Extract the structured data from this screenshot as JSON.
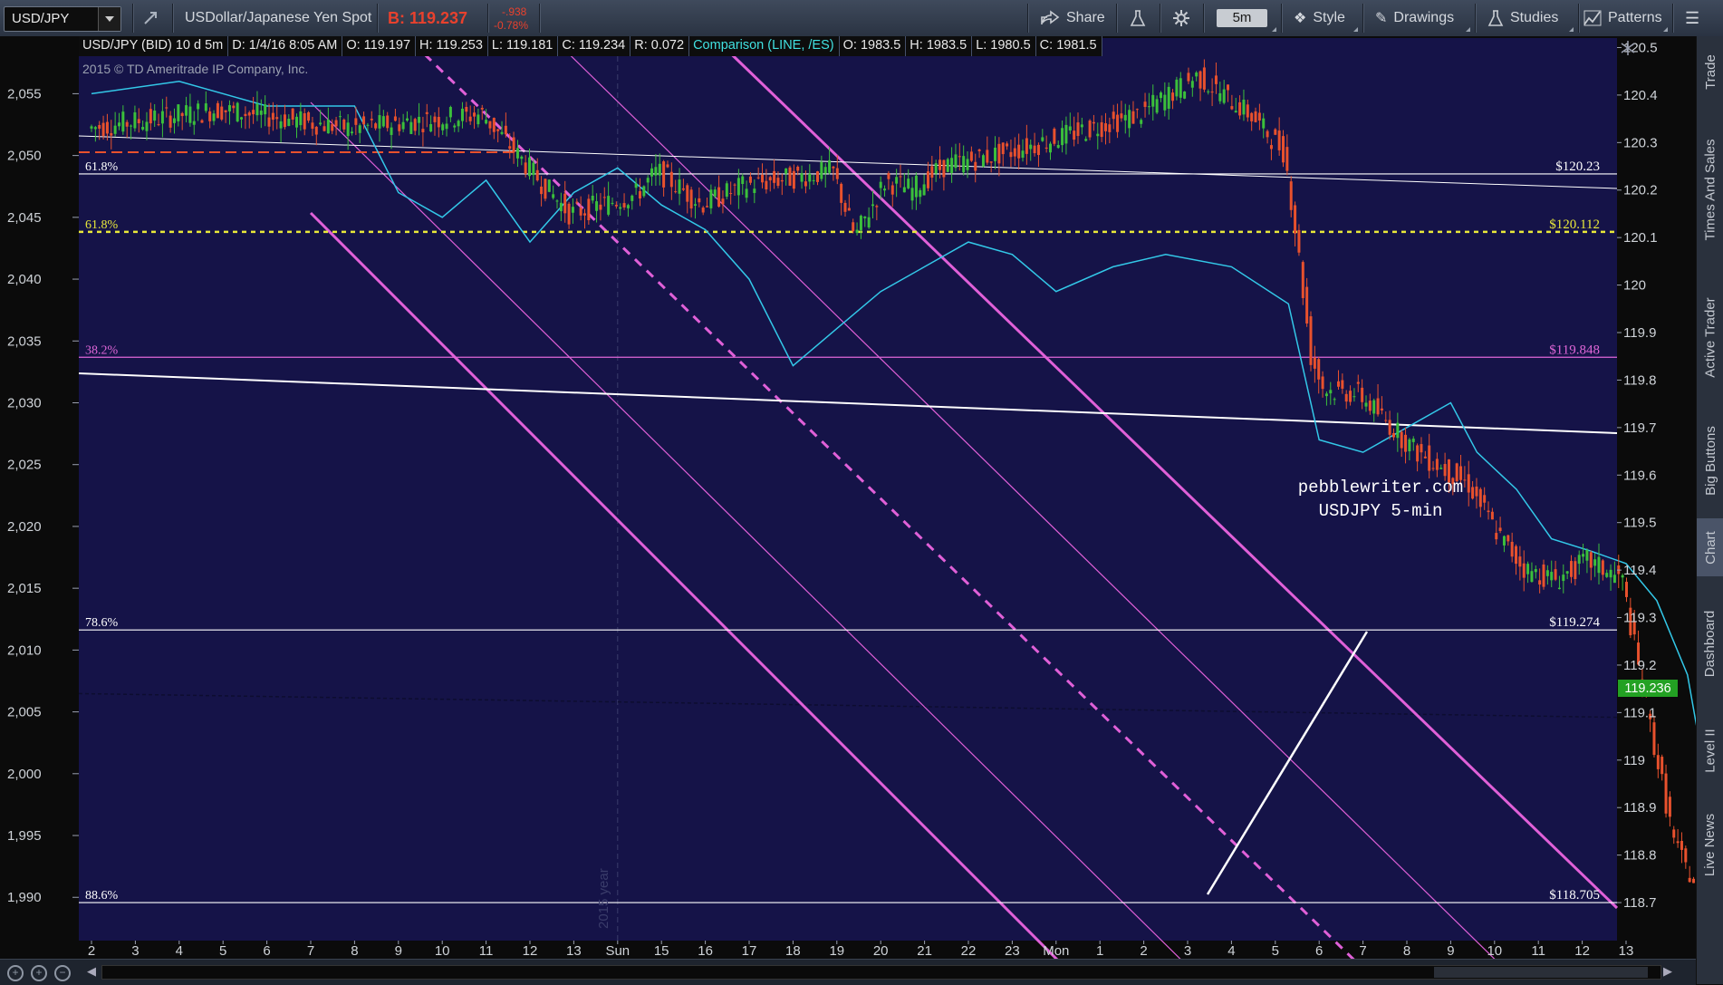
{
  "toolbar": {
    "symbol": "USD/JPY",
    "description": "USDollar/Japanese Yen Spot",
    "bid": "B: 119.237",
    "change": "-.938",
    "change_pct": "-0.78%",
    "share": "Share",
    "interval": "5m",
    "style": "Style",
    "drawings": "Drawings",
    "studies": "Studies",
    "patterns": "Patterns"
  },
  "info_bar": {
    "title": "USD/JPY (BID) 10 d 5m",
    "date": "D: 1/4/16 8:05 AM",
    "open": "O: 119.197",
    "high": "H: 119.253",
    "low": "L: 119.181",
    "close": "C: 119.234",
    "range": "R: 0.072",
    "comparison": "Comparison (LINE, /ES)",
    "c_open": "O: 1983.5",
    "c_high": "H: 1983.5",
    "c_low": "L: 1980.5",
    "c_close": "C: 1981.5"
  },
  "copyright": "2015 © TD Ameritrade IP Company, Inc.",
  "watermark": {
    "line1": "pebblewriter.com",
    "line2": "USDJPY 5-min"
  },
  "year_marker": "2015 year",
  "fib_levels": [
    {
      "label": "61.8%",
      "price": "$120.23",
      "value": 120.234,
      "color": "#ffffff",
      "dashed": false
    },
    {
      "label": "61.8%",
      "price": "$120.112",
      "value": 120.112,
      "color": "#e8e83a",
      "dashed": true
    },
    {
      "label": "38.2%",
      "price": "$119.848",
      "value": 119.848,
      "color": "#e067d8",
      "dashed": false
    },
    {
      "label": "78.6%",
      "price": "$119.274",
      "value": 119.274,
      "color": "#ffffff",
      "dashed": false
    },
    {
      "label": "88.6%",
      "price": "$118.705",
      "value": 118.7,
      "color": "#ffffff",
      "dashed": false
    }
  ],
  "last_price": "119.236",
  "colors": {
    "bg": "#151348",
    "up": "#3bbf3b",
    "down": "#e8512d",
    "compare": "#33c8e8",
    "channel": "#e060d8"
  },
  "right_tabs": [
    "Trade",
    "Times And Sales",
    "Active Trader",
    "Big Buttons",
    "Chart",
    "Dashboard",
    "Level II",
    "Live News"
  ],
  "chart_data": {
    "type": "candlestick",
    "left_axis": {
      "label": "/ES",
      "ticks": [
        "2,055",
        "2,050",
        "2,045",
        "2,040",
        "2,035",
        "2,030",
        "2,025",
        "2,020",
        "2,015",
        "2,010",
        "2,005",
        "2,000",
        "1,995",
        "1,990"
      ],
      "min": 1986.5,
      "max": 2059.5
    },
    "right_axis": {
      "label": "USD/JPY",
      "ticks": [
        "120.5",
        "120.4",
        "120.3",
        "120.2",
        "120.1",
        "120",
        "119.9",
        "119.8",
        "119.7",
        "119.6",
        "119.5",
        "119.4",
        "119.3",
        "119.2",
        "119.1",
        "119",
        "118.9",
        "118.8",
        "118.7"
      ],
      "min": 118.62,
      "max": 120.52
    },
    "x_ticks": [
      "2",
      "3",
      "4",
      "5",
      "6",
      "7",
      "8",
      "9",
      "10",
      "11",
      "12",
      "13",
      "Sun",
      "15",
      "16",
      "17",
      "18",
      "19",
      "20",
      "21",
      "22",
      "23",
      "Mon",
      "1",
      "2",
      "3",
      "4",
      "5",
      "6",
      "7",
      "8",
      "9",
      "10",
      "11",
      "12",
      "13"
    ],
    "usdjpy_path": [
      [
        0,
        120.33
      ],
      [
        3,
        120.37
      ],
      [
        6,
        120.33
      ],
      [
        9,
        120.36
      ],
      [
        10.5,
        120.2
      ],
      [
        11,
        120.15
      ],
      [
        12.5,
        120.19
      ],
      [
        13,
        120.24
      ],
      [
        14,
        120.17
      ],
      [
        15,
        120.21
      ],
      [
        17,
        120.24
      ],
      [
        17.5,
        120.1
      ],
      [
        18.2,
        120.22
      ],
      [
        18.8,
        120.2
      ],
      [
        19.5,
        120.25
      ],
      [
        21,
        120.28
      ],
      [
        22.5,
        120.32
      ],
      [
        24,
        120.36
      ],
      [
        25.3,
        120.44
      ],
      [
        26.5,
        120.36
      ],
      [
        27.3,
        120.28
      ],
      [
        27.6,
        120.08
      ],
      [
        27.9,
        119.85
      ],
      [
        28.2,
        119.78
      ],
      [
        29,
        119.77
      ],
      [
        30.3,
        119.65
      ],
      [
        31.5,
        119.58
      ],
      [
        32.2,
        119.47
      ],
      [
        32.8,
        119.4
      ],
      [
        33.5,
        119.38
      ],
      [
        34.2,
        119.42
      ],
      [
        35,
        119.38
      ],
      [
        35.4,
        119.18
      ],
      [
        35.8,
        119.0
      ],
      [
        36.2,
        118.82
      ],
      [
        36.7,
        118.73
      ],
      [
        37,
        118.85
      ],
      [
        37.4,
        118.95
      ],
      [
        37.8,
        119.03
      ],
      [
        38.3,
        118.93
      ],
      [
        38.8,
        118.9
      ],
      [
        39.2,
        118.95
      ],
      [
        39.6,
        118.98
      ],
      [
        40.1,
        118.9
      ],
      [
        40.5,
        118.82
      ],
      [
        41,
        118.76
      ],
      [
        41.6,
        118.82
      ],
      [
        42,
        118.9
      ],
      [
        42.6,
        119.03
      ],
      [
        43.1,
        119.12
      ],
      [
        43.6,
        119.25
      ],
      [
        44,
        119.33
      ],
      [
        44.4,
        119.18
      ],
      [
        45,
        119.1
      ],
      [
        45.6,
        119.15
      ],
      [
        46,
        119.25
      ],
      [
        46.5,
        119.28
      ],
      [
        47,
        119.2
      ]
    ],
    "es_path": [
      [
        0,
        2055
      ],
      [
        2,
        2056
      ],
      [
        4,
        2054
      ],
      [
        6,
        2054
      ],
      [
        7,
        2047
      ],
      [
        8,
        2045
      ],
      [
        9,
        2048
      ],
      [
        10,
        2043
      ],
      [
        11,
        2047
      ],
      [
        12,
        2049
      ],
      [
        13,
        2046
      ],
      [
        14,
        2044
      ],
      [
        15,
        2040
      ],
      [
        16,
        2033
      ],
      [
        17,
        2036
      ],
      [
        18,
        2039
      ],
      [
        19,
        2041
      ],
      [
        20,
        2043
      ],
      [
        21,
        2042
      ],
      [
        22,
        2039
      ],
      [
        23.3,
        2041
      ],
      [
        24.5,
        2042
      ],
      [
        26,
        2041
      ],
      [
        27.3,
        2038
      ],
      [
        28,
        2027
      ],
      [
        29,
        2026
      ],
      [
        30,
        2028
      ],
      [
        31,
        2030
      ],
      [
        31.6,
        2026
      ],
      [
        32.5,
        2023
      ],
      [
        33.3,
        2019
      ],
      [
        34.2,
        2018
      ],
      [
        35,
        2017
      ],
      [
        35.7,
        2014
      ],
      [
        36.4,
        2008
      ],
      [
        36.8,
        2000
      ],
      [
        37.4,
        2005
      ],
      [
        38,
        2008
      ],
      [
        38.7,
        2001
      ],
      [
        39.4,
        2000
      ],
      [
        40.2,
        2007
      ],
      [
        40.8,
        2005
      ],
      [
        41.5,
        2003
      ],
      [
        42.2,
        2004
      ],
      [
        42.8,
        2001
      ],
      [
        43.4,
        1998
      ],
      [
        44,
        2005
      ],
      [
        44.6,
        1999
      ],
      [
        45.3,
        2002
      ],
      [
        46,
        1996
      ],
      [
        46.6,
        1993
      ],
      [
        47,
        1991
      ]
    ]
  }
}
